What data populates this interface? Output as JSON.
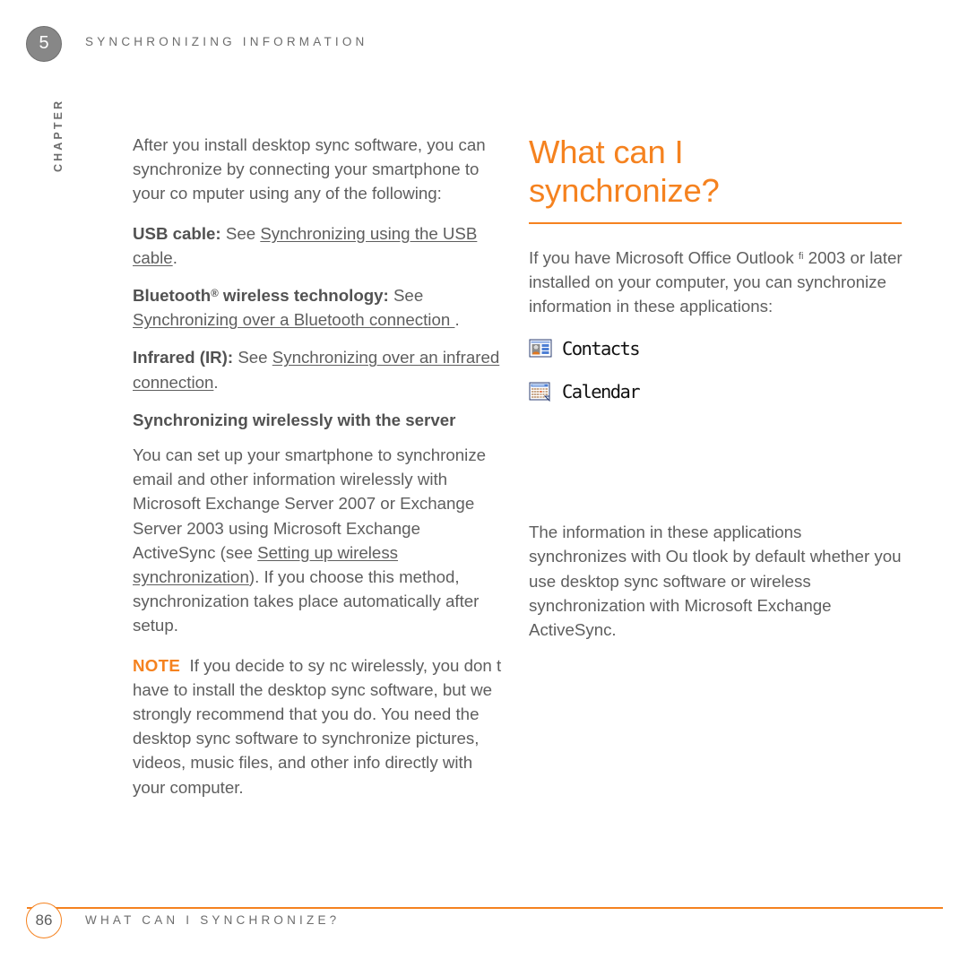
{
  "header": {
    "chapter_number": "5",
    "chapter_word": "CHAPTER",
    "running_title": "SYNCHRONIZING INFORMATION"
  },
  "colors": {
    "accent_orange": "#F5821F",
    "body_gray": "#5E5E5E",
    "heading_gray": "#525252",
    "badge_gray": "#878787"
  },
  "left_column": {
    "intro_paragraph": "After you install desktop sync software, you can synchronize by connecting your smartphone to your co mputer using any of the following:",
    "methods": [
      {
        "term": "USB cable:",
        "see_word": " See ",
        "xref": "Synchronizing using the USB cable",
        "tail": "."
      },
      {
        "term": "Bluetooth",
        "term_mark": "®",
        "term_rest": " wireless technology:",
        "see_word": " See ",
        "xref": "Synchronizing over a Bluetooth connection ",
        "tail": "."
      },
      {
        "term": "Infrared (IR):",
        "see_word": " See ",
        "xref": "Synchronizing over an infrared connection",
        "tail": "."
      }
    ],
    "sub_heading": "Synchronizing wirelessly with the server",
    "wireless_paragraph_part1": "You can set up your smartphone to synchronize email and other information wirelessly with Microsoft Exchange Server 2007 or Exchange Server 2003 using Microsoft Exchange ActiveSync (see ",
    "wireless_paragraph_xref": "Setting up wireless synchronization",
    "wireless_paragraph_part2": "). If you choose this method, synchronization takes place automatically after setup.",
    "note_label": "NOTE",
    "note_text": "If you decide to sy nc wirelessly, you don t have to install the desktop sync software, but we strongly recommend that you do. You need the desktop sync software to synchronize pictures, videos, music files, and other info directly with your computer."
  },
  "right_column": {
    "title_line1": "What can I",
    "title_line2": "synchronize?",
    "intro_part1": "If you have Microsoft Office Outlook ",
    "intro_mark": "fi",
    "intro_part2": " 2003 or later installed on your computer, you can synchronize information in these applications:",
    "applications": [
      {
        "label": "Contacts",
        "icon": "contacts-card-icon"
      },
      {
        "label": "Calendar",
        "icon": "calendar-grid-icon"
      }
    ],
    "closing_paragraph": "The information in these applications synchronizes with Ou tlook by default whether you use desktop sync software or wireless synchronization with Microsoft Exchange ActiveSync."
  },
  "footer": {
    "page_number": "86",
    "footer_title": "WHAT CAN I SYNCHRONIZE?"
  }
}
